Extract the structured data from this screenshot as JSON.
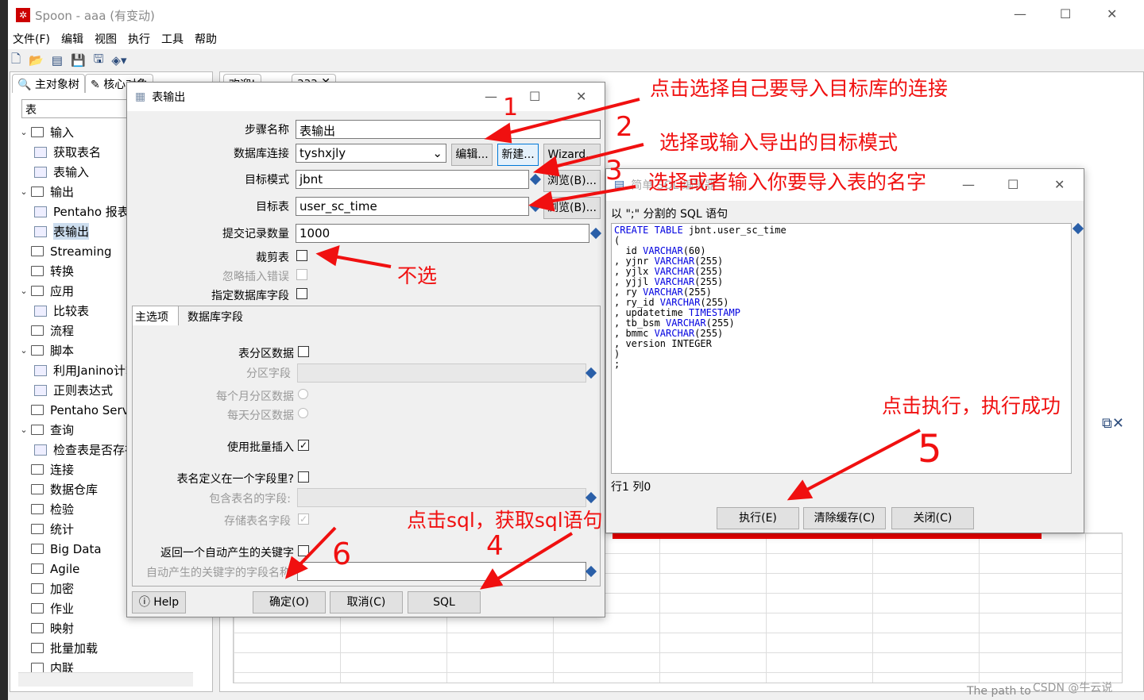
{
  "app": {
    "title": "Spoon - aaa (有变动)",
    "menu": [
      "文件(F)",
      "编辑",
      "视图",
      "执行",
      "工具",
      "帮助"
    ]
  },
  "left": {
    "tabs": [
      "主对象树",
      "核心对象"
    ],
    "search": "表",
    "tree": [
      {
        "label": "输入",
        "type": "folder",
        "open": true,
        "level": 0
      },
      {
        "label": "获取表名",
        "type": "step",
        "level": 1
      },
      {
        "label": "表输入",
        "type": "step",
        "level": 1
      },
      {
        "label": "输出",
        "type": "folder",
        "open": true,
        "level": 0
      },
      {
        "label": "Pentaho 报表输出",
        "type": "step",
        "level": 1
      },
      {
        "label": "表输出",
        "type": "step",
        "level": 1,
        "selected": true
      },
      {
        "label": "Streaming",
        "type": "folder",
        "level": 0
      },
      {
        "label": "转换",
        "type": "folder",
        "level": 0
      },
      {
        "label": "应用",
        "type": "folder",
        "open": true,
        "level": 0
      },
      {
        "label": "比较表",
        "type": "step",
        "level": 1
      },
      {
        "label": "流程",
        "type": "folder",
        "level": 0
      },
      {
        "label": "脚本",
        "type": "folder",
        "open": true,
        "level": 0
      },
      {
        "label": "利用Janino计算",
        "type": "step",
        "level": 1
      },
      {
        "label": "正则表达式",
        "type": "step",
        "level": 1
      },
      {
        "label": "Pentaho Server",
        "type": "folder",
        "level": 0
      },
      {
        "label": "查询",
        "type": "folder",
        "open": true,
        "level": 0
      },
      {
        "label": "检查表是否存在",
        "type": "step",
        "level": 1
      },
      {
        "label": "连接",
        "type": "folder",
        "level": 0
      },
      {
        "label": "数据仓库",
        "type": "folder",
        "level": 0
      },
      {
        "label": "检验",
        "type": "folder",
        "level": 0
      },
      {
        "label": "统计",
        "type": "folder",
        "level": 0
      },
      {
        "label": "Big Data",
        "type": "folder",
        "level": 0
      },
      {
        "label": "Agile",
        "type": "folder",
        "level": 0
      },
      {
        "label": "加密",
        "type": "folder",
        "level": 0
      },
      {
        "label": "作业",
        "type": "folder",
        "level": 0
      },
      {
        "label": "映射",
        "type": "folder",
        "level": 0
      },
      {
        "label": "批量加载",
        "type": "folder",
        "level": 0
      },
      {
        "label": "内联",
        "type": "folder",
        "level": 0
      }
    ]
  },
  "right": {
    "tabs": [
      "欢迎!",
      "aaa"
    ],
    "footer": "The path to"
  },
  "table_output": {
    "title": "表输出",
    "step_name_label": "步骤名称",
    "step_name": "表输出",
    "db_conn_label": "数据库连接",
    "db_conn": "tyshxjly",
    "edit": "编辑...",
    "new": "新建...",
    "wizard": "Wizard...",
    "schema_label": "目标模式",
    "schema": "jbnt",
    "browse": "浏览(B)...",
    "table_label": "目标表",
    "table": "user_sc_time",
    "commit_label": "提交记录数量",
    "commit": "1000",
    "truncate_label": "裁剪表",
    "ignore_label": "忽略插入错误",
    "specify_label": "指定数据库字段",
    "tabs": [
      "主选项",
      "数据库字段"
    ],
    "partition_label": "表分区数据",
    "partition_field_label": "分区字段",
    "monthly_label": "每个月分区数据",
    "daily_label": "每天分区数据",
    "batch_label": "使用批量插入",
    "batch": true,
    "name_in_field_label": "表名定义在一个字段里?",
    "name_field_label": "包含表名的字段:",
    "store_name_label": "存储表名字段",
    "return_key_label": "返回一个自动产生的关键字",
    "key_field_label": "自动产生的关键字的字段名称",
    "help": "Help",
    "ok": "确定(O)",
    "cancel": "取消(C)",
    "sql": "SQL"
  },
  "sql_editor": {
    "title": "简单 SQL 编辑器",
    "prompt": "以 \";\" 分割的 SQL 语句",
    "lines": [
      [
        [
          "CREATE TABLE",
          "kw"
        ],
        [
          " jbnt.user_sc_time",
          ""
        ]
      ],
      [
        [
          "(",
          ""
        ]
      ],
      [
        [
          "  id ",
          ""
        ],
        [
          "VARCHAR",
          "kw"
        ],
        [
          "(60)",
          ""
        ]
      ],
      [
        [
          ", yjnr ",
          ""
        ],
        [
          "VARCHAR",
          "kw"
        ],
        [
          "(255)",
          ""
        ]
      ],
      [
        [
          ", yjlx ",
          ""
        ],
        [
          "VARCHAR",
          "kw"
        ],
        [
          "(255)",
          ""
        ]
      ],
      [
        [
          ", yjjl ",
          ""
        ],
        [
          "VARCHAR",
          "kw"
        ],
        [
          "(255)",
          ""
        ]
      ],
      [
        [
          ", ry ",
          ""
        ],
        [
          "VARCHAR",
          "kw"
        ],
        [
          "(255)",
          ""
        ]
      ],
      [
        [
          ", ry_id ",
          ""
        ],
        [
          "VARCHAR",
          "kw"
        ],
        [
          "(255)",
          ""
        ]
      ],
      [
        [
          ", updatetime ",
          ""
        ],
        [
          "TIMESTAMP",
          "kw"
        ]
      ],
      [
        [
          ", tb_bsm ",
          ""
        ],
        [
          "VARCHAR",
          "kw"
        ],
        [
          "(255)",
          ""
        ]
      ],
      [
        [
          ", bmmc ",
          ""
        ],
        [
          "VARCHAR",
          "kw"
        ],
        [
          "(255)",
          ""
        ]
      ],
      [
        [
          ", version INTEGER",
          ""
        ]
      ],
      [
        [
          ")",
          ""
        ]
      ],
      [
        [
          ";",
          ""
        ]
      ]
    ],
    "position": "行1 列0",
    "execute": "执行(E)",
    "clear": "清除缓存(C)",
    "close": "关闭(C)"
  },
  "annotations": {
    "a1": "点击选择自己要导入目标库的连接",
    "a2": "选择或输入导出的目标模式",
    "a3": "选择或者输入你要导入表的名字",
    "a4": "不选",
    "a5": "点击执行，执行成功",
    "a6": "点击sql，获取sql语句",
    "n1": "1",
    "n2": "2",
    "n3": "3",
    "n4": "4",
    "n5": "5",
    "n6": "6"
  },
  "watermark": "CSDN @牛云说",
  "colors": {
    "annotation": "#f01010",
    "keyword": "#0000e0",
    "brand": "#cc0000"
  }
}
